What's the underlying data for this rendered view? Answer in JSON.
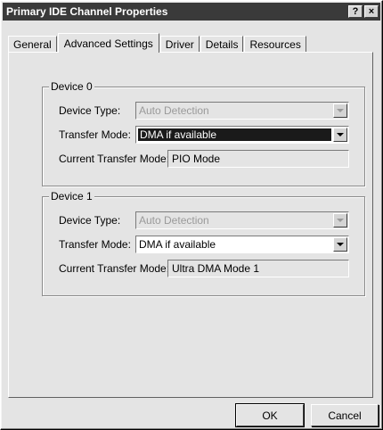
{
  "window": {
    "title": "Primary IDE Channel Properties",
    "help_label": "?",
    "close_label": "×"
  },
  "tabs": [
    {
      "label": "General"
    },
    {
      "label": "Advanced Settings"
    },
    {
      "label": "Driver"
    },
    {
      "label": "Details"
    },
    {
      "label": "Resources"
    }
  ],
  "device0": {
    "group_label": "Device 0",
    "device_type_label": "Device Type:",
    "device_type_value": "Auto Detection",
    "transfer_mode_label": "Transfer Mode:",
    "transfer_mode_value": "DMA if available",
    "current_mode_label": "Current Transfer Mode:",
    "current_mode_value": "PIO Mode"
  },
  "device1": {
    "group_label": "Device 1",
    "device_type_label": "Device Type:",
    "device_type_value": "Auto Detection",
    "transfer_mode_label": "Transfer Mode:",
    "transfer_mode_value": "DMA if available",
    "current_mode_label": "Current Transfer Mode:",
    "current_mode_value": "Ultra DMA Mode 1"
  },
  "buttons": {
    "ok": "OK",
    "cancel": "Cancel"
  }
}
